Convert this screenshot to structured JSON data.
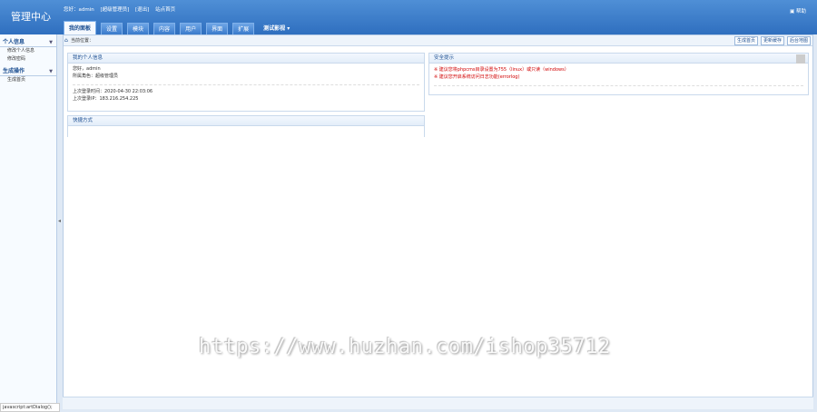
{
  "header": {
    "brand": "管理中心",
    "user_info": [
      "您好：admin",
      "[超级管理员]",
      "[退出]",
      "站点首页"
    ],
    "help": "帮助",
    "tabs": [
      "我的面板",
      "设置",
      "模块",
      "内容",
      "用户",
      "界面",
      "扩展",
      "测试影视"
    ]
  },
  "sidebar": {
    "groups": [
      {
        "title": "个人信息",
        "items": [
          "修改个人信息",
          "修改密码"
        ]
      },
      {
        "title": "生成操作",
        "items": [
          "生成首页"
        ]
      }
    ]
  },
  "breadcrumb": {
    "label": "当前位置：",
    "buttons": [
      "生成首页",
      "更新缓存",
      "后台地图"
    ]
  },
  "panels": {
    "personal": {
      "title": "我的个人信息",
      "lines": [
        "您好，admin",
        "所属角色：超级管理员"
      ],
      "login_lines": [
        "上次登录时间：2020-04-30 22:03:06",
        "上次登录IP：183.216.254.225"
      ]
    },
    "shortcut": {
      "title": "快捷方式"
    },
    "security": {
      "title": "安全提示",
      "lines": [
        "※ 建议您将phpcms目录设置为755（linux）或只读（windows）",
        "※ 建议您开启系统访问日志功能(errorlog)"
      ]
    }
  },
  "status_bar": "javascript:artDialog();",
  "watermark": "https://www.huzhan.com/ishop35712"
}
